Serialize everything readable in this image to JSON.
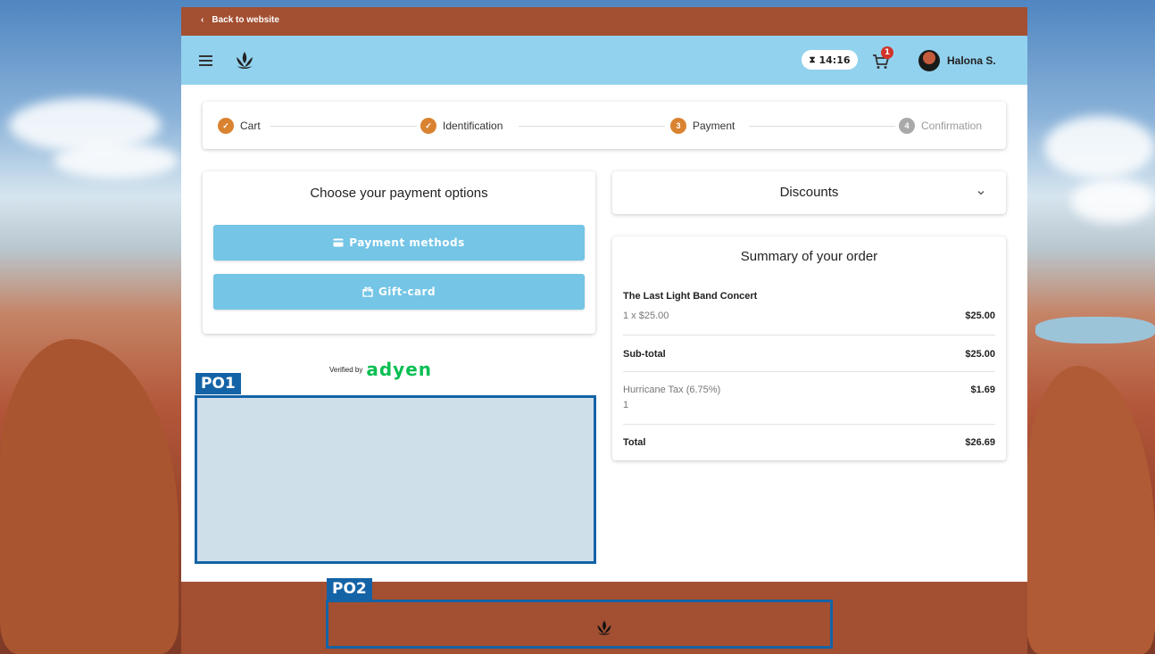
{
  "top_bar": {
    "back_label": "Back to website",
    "back_chevron": "‹"
  },
  "header": {
    "timer": "14:16",
    "cart_count": "1",
    "user_name": "Halona S."
  },
  "stepper": {
    "steps": [
      {
        "label": "Cart",
        "marker": "✓",
        "state": "done"
      },
      {
        "label": "Identification",
        "marker": "✓",
        "state": "done"
      },
      {
        "label": "Payment",
        "marker": "3",
        "state": "active"
      },
      {
        "label": "Confirmation",
        "marker": "4",
        "state": "inactive"
      }
    ]
  },
  "payment": {
    "title": "Choose your payment options",
    "methods_label": "Payment methods",
    "giftcard_label": "Gift-card",
    "verified_by": "Verified by",
    "provider": "adyen"
  },
  "discounts": {
    "title": "Discounts"
  },
  "summary": {
    "title": "Summary of your order",
    "item_name": "The Last Light Band Concert",
    "item_qty": "1 x $25.00",
    "item_price": "$25.00",
    "subtotal_label": "Sub-total",
    "subtotal_value": "$25.00",
    "tax_label": "Hurricane Tax (6.75%)",
    "tax_sub": "1",
    "tax_value": "$1.69",
    "total_label": "Total",
    "total_value": "$26.69"
  },
  "placeholders": {
    "po1": "PO1",
    "po2": "PO2"
  },
  "colors": {
    "brand_brown": "#a34f32",
    "header_blue": "#92d2ee",
    "button_blue": "#74c5e6",
    "step_orange": "#d98331",
    "placeholder_blue": "#1463a6",
    "adyen_green": "#0abf53"
  },
  "icons": {
    "menu": "menu-icon",
    "logo": "lotus-logo-icon",
    "hourglass": "hourglass-icon",
    "cart": "cart-icon",
    "avatar": "avatar",
    "card": "credit-card-icon",
    "gift": "gift-icon",
    "chevron": "chevron-down-icon"
  }
}
